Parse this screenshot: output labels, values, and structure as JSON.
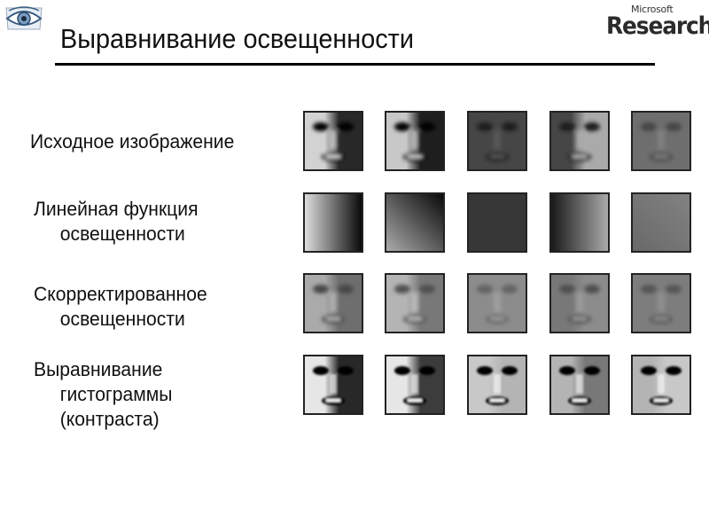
{
  "header": {
    "title": "Выравнивание освещенности",
    "logo_left": "eye-logo",
    "logo_right": {
      "small": "Microsoft",
      "big": "Research"
    }
  },
  "rows": [
    {
      "label_line1": "Исходное изображение",
      "label_line2": ""
    },
    {
      "label_line1": "Линейная функция",
      "label_line2": "освещенности"
    },
    {
      "label_line1": "Скорректированное",
      "label_line2": "освещенности"
    },
    {
      "label_line1": "Выравнивание",
      "label_line2": "гистограммы",
      "label_line3": "(контраста)"
    }
  ],
  "columns_count": 5,
  "images": [
    [
      "face-original-1",
      "face-original-2",
      "face-original-3",
      "face-original-4",
      "face-original-5"
    ],
    [
      "linear-gradient-1",
      "linear-gradient-2",
      "linear-gradient-3",
      "linear-gradient-4",
      "linear-gradient-5"
    ],
    [
      "face-corrected-1",
      "face-corrected-2",
      "face-corrected-3",
      "face-corrected-4",
      "face-corrected-5"
    ],
    [
      "face-equalized-1",
      "face-equalized-2",
      "face-equalized-3",
      "face-equalized-4",
      "face-equalized-5"
    ]
  ]
}
